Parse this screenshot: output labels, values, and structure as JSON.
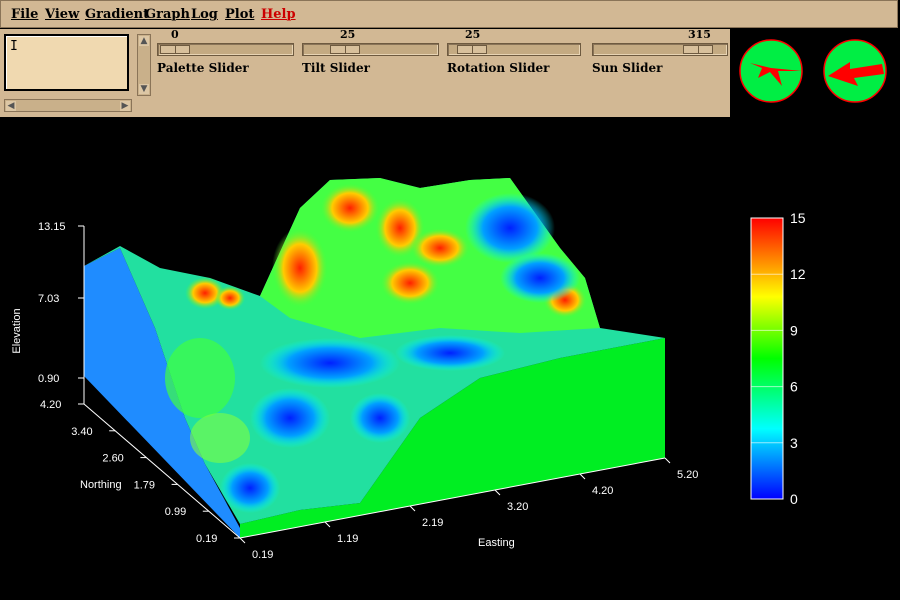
{
  "menu": {
    "items": [
      {
        "label": "File"
      },
      {
        "label": "View"
      },
      {
        "label": "Gradient"
      },
      {
        "label": "Graph"
      },
      {
        "label": "Log"
      },
      {
        "label": "Plot"
      },
      {
        "label": "Help"
      }
    ]
  },
  "textbox": {
    "value": "I"
  },
  "sliders": [
    {
      "label": "Palette Slider",
      "value": "0",
      "fraction": 0.0
    },
    {
      "label": "Tilt Slider",
      "value": "25",
      "fraction": 0.25
    },
    {
      "label": "Rotation Slider",
      "value": "25",
      "fraction": 0.07
    },
    {
      "label": "Sun Slider",
      "value": "315",
      "fraction": 0.875
    }
  ],
  "compass": {
    "rotation_icon": "arrow-direction-icon",
    "sun_icon": "arrow-direction-icon",
    "fill_color": "#00ee44",
    "border_color": "#ff0000",
    "arrow_color": "#ff0000"
  },
  "chart_data": {
    "type": "surface3d",
    "zlabel": "Elevation",
    "ylabel": "Northing",
    "xlabel": "Easting",
    "z_ticks": [
      "13.15",
      "7.03",
      "0.90"
    ],
    "y_ticks": [
      "4.20",
      "3.40",
      "2.60",
      "1.79",
      "0.99",
      "0.19"
    ],
    "x_ticks": [
      "0.19",
      "1.19",
      "2.19",
      "3.20",
      "4.20",
      "5.20"
    ],
    "zlim": [
      0.9,
      13.15
    ],
    "ylim": [
      0.19,
      4.2
    ],
    "xlim": [
      0.19,
      5.2
    ],
    "colorbar": {
      "ticks": [
        "15",
        "12",
        "9",
        "6",
        "3",
        "0"
      ],
      "range": [
        0,
        15
      ],
      "colors": [
        "#0000ff",
        "#00ffff",
        "#00ff00",
        "#ffff00",
        "#ff0000"
      ]
    }
  }
}
